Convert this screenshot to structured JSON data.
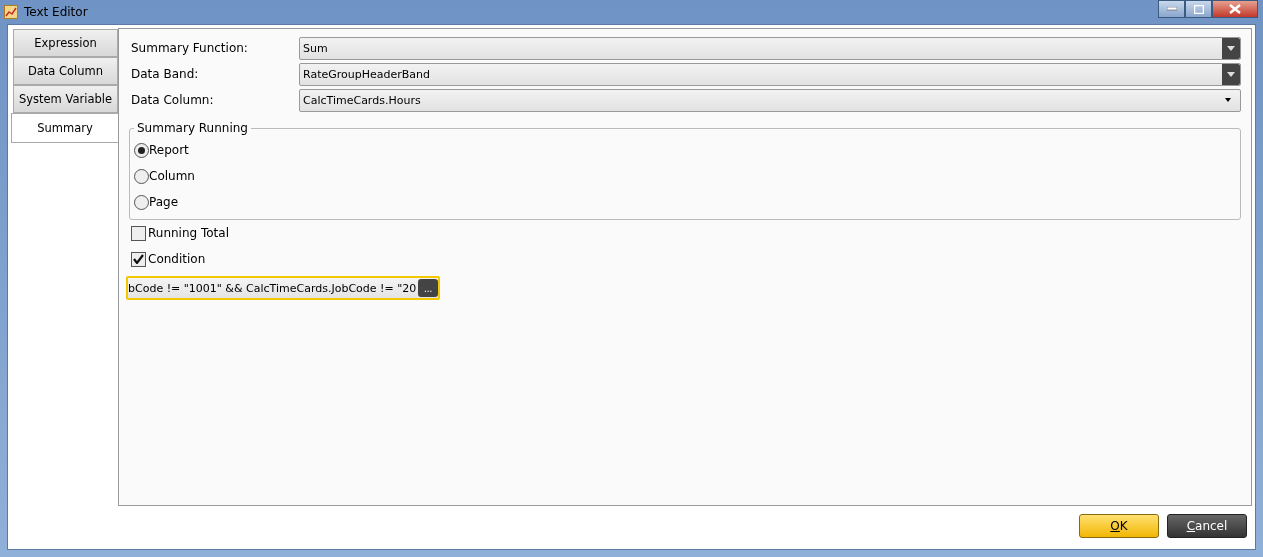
{
  "window": {
    "title": "Text Editor"
  },
  "tabs": [
    {
      "label": "Expression",
      "selected": false
    },
    {
      "label": "Data Column",
      "selected": false
    },
    {
      "label": "System Variable",
      "selected": false
    },
    {
      "label": "Summary",
      "selected": true
    }
  ],
  "fields": [
    {
      "label": "Summary Function:",
      "value": "Sum",
      "kind": "dark"
    },
    {
      "label": "Data Band:",
      "value": "RateGroupHeaderBand",
      "kind": "dark"
    },
    {
      "label": "Data Column:",
      "value": "CalcTimeCards.Hours",
      "kind": "plain"
    }
  ],
  "summary_running": {
    "legend": "Summary Running",
    "options": [
      {
        "label": "Report",
        "selected": true
      },
      {
        "label": "Column",
        "selected": false
      },
      {
        "label": "Page",
        "selected": false
      }
    ]
  },
  "checkboxes": [
    {
      "label": "Running Total",
      "checked": false
    },
    {
      "label": "Condition",
      "checked": true
    }
  ],
  "condition": {
    "value": "bCode != \"1001\" && CalcTimeCards.JobCode != \"20",
    "button": "..."
  },
  "buttons": [
    {
      "label": "OK",
      "kind": "primary",
      "access_key_underlined": true
    },
    {
      "label": "Cancel",
      "kind": "dark",
      "access_key_underlined": true
    }
  ]
}
